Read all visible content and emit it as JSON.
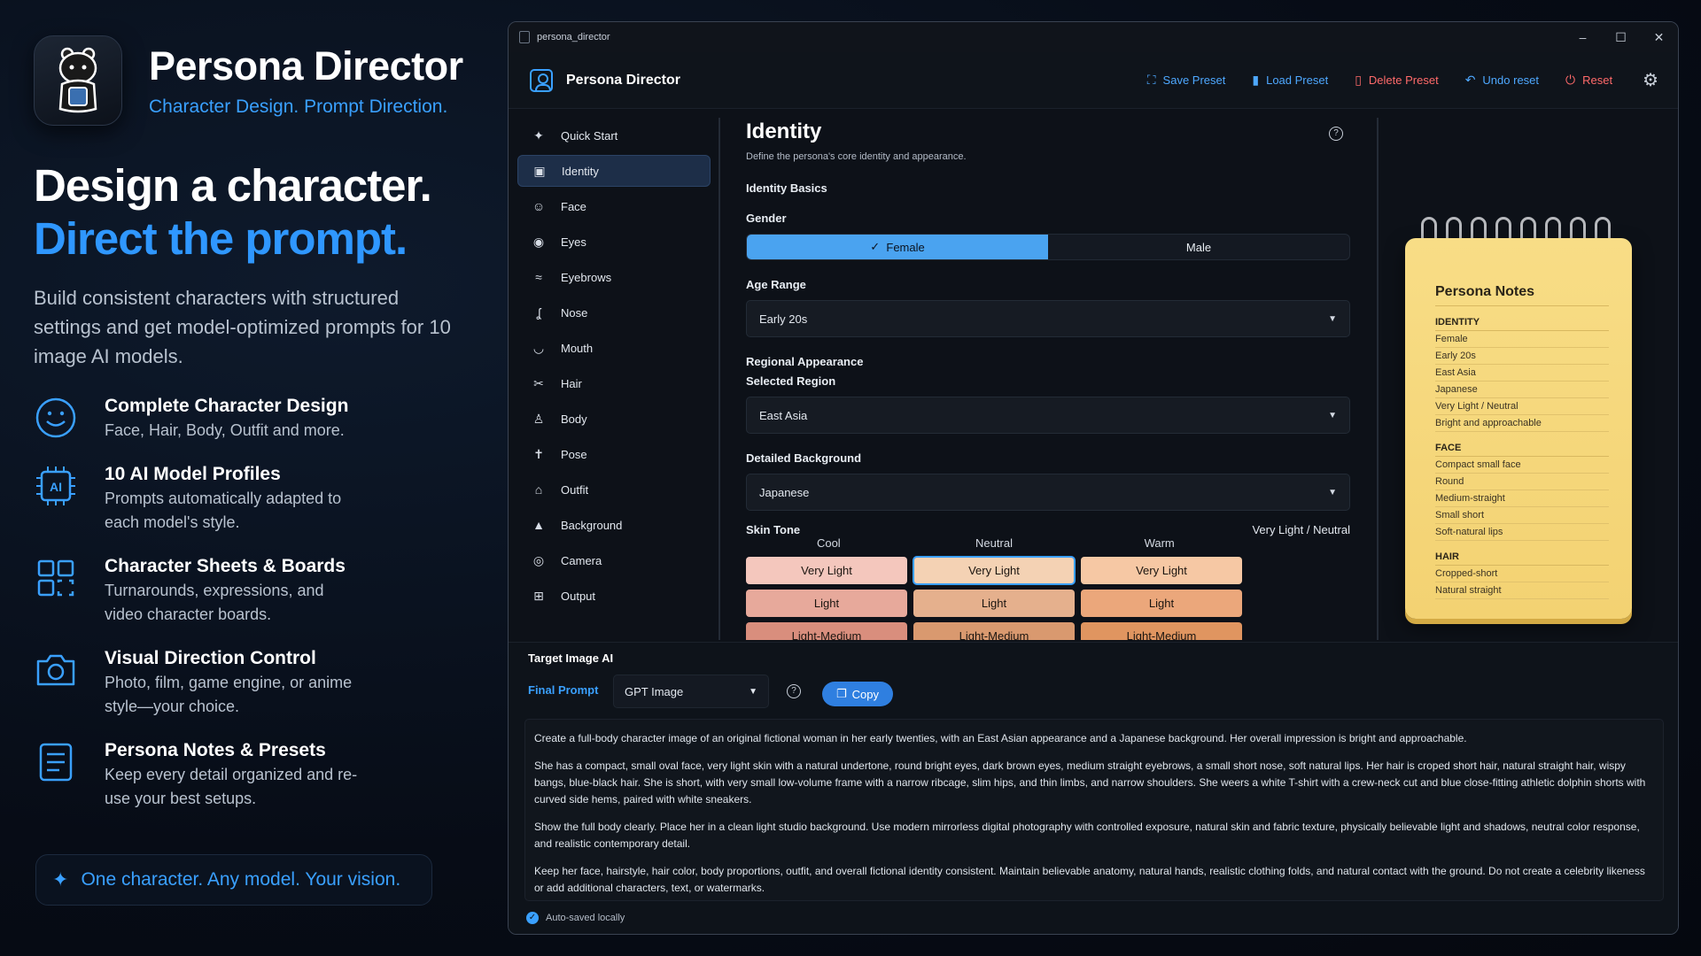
{
  "promo": {
    "brand_name": "Persona Director",
    "brand_tagline": "Character Design. Prompt Direction.",
    "headline_1": "Design a character.",
    "headline_2": "Direct the prompt.",
    "description": "Build consistent characters with structured settings and get model-optimized prompts for 10 image AI models.",
    "features": [
      {
        "icon": "smiley-icon",
        "title": "Complete Character Design",
        "desc": "Face, Hair, Body, Outfit and more."
      },
      {
        "icon": "ai-chip-icon",
        "title": "10 AI Model Profiles",
        "desc": "Prompts automatically adapted to each model's style."
      },
      {
        "icon": "grid-board-icon",
        "title": "Character Sheets & Boards",
        "desc": "Turnarounds, expressions, and video character boards."
      },
      {
        "icon": "camera-icon",
        "title": "Visual Direction Control",
        "desc": "Photo, film, game engine, or anime style—your choice."
      },
      {
        "icon": "notes-icon",
        "title": "Persona Notes & Presets",
        "desc": "Keep every detail organized and re-use your best setups."
      }
    ],
    "callout": "One character. Any model. Your vision."
  },
  "window": {
    "title": "persona_director",
    "controls": [
      "–",
      "☐",
      "✕"
    ]
  },
  "appbar": {
    "title": "Persona Director",
    "actions": [
      {
        "label": "Save Preset",
        "icon": "save-icon",
        "glyph": "⛶"
      },
      {
        "label": "Load Preset",
        "icon": "bookmark-icon",
        "glyph": "🔖"
      },
      {
        "label": "Delete Preset",
        "icon": "trash-icon",
        "glyph": "🗑"
      },
      {
        "label": "Undo reset",
        "icon": "undo-icon",
        "glyph": "↶"
      },
      {
        "label": "Reset",
        "icon": "power-icon",
        "glyph": "⏻"
      }
    ]
  },
  "sidebar": {
    "items": [
      {
        "label": "Quick Start",
        "icon": "sparkle-icon",
        "glyph": "✦"
      },
      {
        "label": "Identity",
        "icon": "id-badge-icon",
        "glyph": "▣",
        "active": true
      },
      {
        "label": "Face",
        "icon": "face-icon",
        "glyph": "☺"
      },
      {
        "label": "Eyes",
        "icon": "eye-icon",
        "glyph": "◉"
      },
      {
        "label": "Eyebrows",
        "icon": "eyebrow-icon",
        "glyph": "≈"
      },
      {
        "label": "Nose",
        "icon": "nose-icon",
        "glyph": "ʆ"
      },
      {
        "label": "Mouth",
        "icon": "mouth-icon",
        "glyph": "◡"
      },
      {
        "label": "Hair",
        "icon": "scissors-icon",
        "glyph": "✂"
      },
      {
        "label": "Body",
        "icon": "body-icon",
        "glyph": "♙"
      },
      {
        "label": "Pose",
        "icon": "pose-icon",
        "glyph": "✝"
      },
      {
        "label": "Outfit",
        "icon": "hanger-icon",
        "glyph": "⌂"
      },
      {
        "label": "Background",
        "icon": "mountain-icon",
        "glyph": "▲"
      },
      {
        "label": "Camera",
        "icon": "camera-icon",
        "glyph": "◎"
      },
      {
        "label": "Output",
        "icon": "grid-icon",
        "glyph": "⊞"
      }
    ]
  },
  "identity": {
    "title": "Identity",
    "subtitle": "Define the persona's core identity and appearance.",
    "basics_label": "Identity Basics",
    "gender_label": "Gender",
    "gender_options": [
      "Female",
      "Male"
    ],
    "gender_selected": "Female",
    "age_label": "Age Range",
    "age_value": "Early 20s",
    "regional_label": "Regional Appearance",
    "region_label": "Selected Region",
    "region_value": "East Asia",
    "background_label": "Detailed Background",
    "background_value": "Japanese",
    "skin_label": "Skin Tone",
    "skin_value": "Very Light / Neutral",
    "skin_columns": [
      "Cool",
      "Neutral",
      "Warm"
    ],
    "skin_rows": [
      [
        {
          "label": "Very Light",
          "color": "#f4c7bd"
        },
        {
          "label": "Very Light",
          "color": "#f4d2b4",
          "selected": true
        },
        {
          "label": "Very Light",
          "color": "#f6c8a4"
        }
      ],
      [
        {
          "label": "Light",
          "color": "#e7a99b"
        },
        {
          "label": "Light",
          "color": "#e5b08d"
        },
        {
          "label": "Light",
          "color": "#eba77b"
        }
      ],
      [
        {
          "label": "Light-Medium",
          "color": "#d98e7d"
        },
        {
          "label": "Light-Medium",
          "color": "#d9996f"
        },
        {
          "label": "Light-Medium",
          "color": "#e09560"
        }
      ]
    ]
  },
  "notes": {
    "title": "Persona Notes",
    "sections": [
      {
        "heading": "IDENTITY",
        "items": [
          "Female",
          "Early 20s",
          "East Asia",
          "Japanese",
          "Very Light / Neutral",
          "Bright and approachable"
        ]
      },
      {
        "heading": "FACE",
        "items": [
          "Compact small face",
          "Round",
          "Medium-straight",
          "Small short",
          "Soft-natural lips"
        ]
      },
      {
        "heading": "HAIR",
        "items": [
          "Cropped-short",
          "Natural straight"
        ]
      }
    ]
  },
  "prompt": {
    "target_label": "Target Image AI",
    "final_label": "Final Prompt",
    "model_value": "GPT Image",
    "copy_label": "Copy",
    "paragraphs": [
      "Create a full-body character image of an original fictional woman in her early twenties, with an East Asian appearance and a Japanese background. Her overall impression is bright and approachable.",
      "She has a compact, small oval face, very light skin with a natural undertone, round bright eyes, dark brown eyes, medium straight eyebrows, a small short nose, soft natural lips. Her hair is croped short hair, natural straight hair, wispy bangs, blue-black hair. She is short, with very small low-volume frame with a narrow ribcage, slim hips, and thin limbs, and narrow shoulders. She weers a white T-shirt with a crew-neck cut and blue close-fitting athletic dolphin shorts with curved side hems, paired with white snеakers.",
      "Show the full body clearly. Place her in a clean light studio background. Use modern mirrorless digital photography with controlled exposure, natural skin and fabric texture, physically believable light and shadows, neutral color response, and realistic contemporary detail.",
      "Keep her face, hairstyle, hair color, body proportions, outfit, and overall fictional identity consistent. Maintain believable anatomy, natural hands, realistic clothing folds, and natural contact with the ground. Do not create a celebrity likeness or add additional characters, text, or watermarks."
    ],
    "autosave": "Auto-saved locally"
  },
  "colors": {
    "accent": "#3aa0ff",
    "danger": "#ff6a6a",
    "notepad": "#f6d878"
  }
}
